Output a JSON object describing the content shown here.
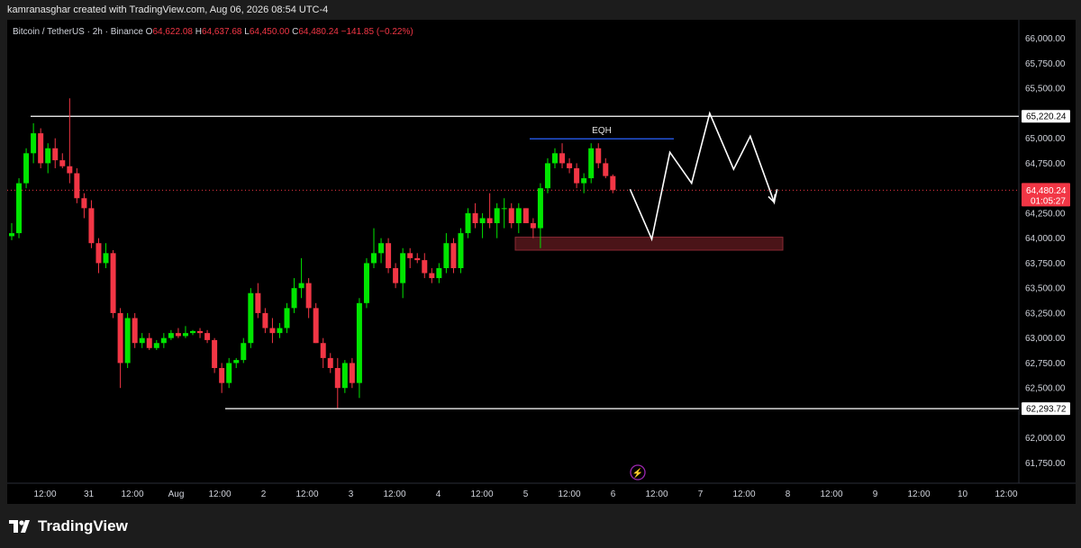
{
  "header": {
    "credit": "kamranasghar created with TradingView.com, Aug 06, 2026 08:54 UTC-4"
  },
  "legend": {
    "symbol": "Bitcoin / TetherUS · 2h · Binance",
    "o_label": "O",
    "o_value": "64,622.08",
    "h_label": "H",
    "h_value": "64,637.68",
    "l_label": "L",
    "l_value": "64,450.00",
    "c_label": "C",
    "c_value": "64,480.24",
    "change": "−141.85 (−0.22%)"
  },
  "brand": {
    "name": "TradingView"
  },
  "colors": {
    "up": "#00e600",
    "down": "#f23645",
    "level_line": "#ffffff",
    "eqh_line": "#2962ff",
    "zone": "#4a1418"
  },
  "chart_data": {
    "type": "candlestick",
    "symbol": "Bitcoin / TetherUS",
    "interval": "2h",
    "exchange": "Binance",
    "ylim": [
      61600,
      66150
    ],
    "y_ticks": [
      {
        "value": 66000,
        "label": "66,000.00"
      },
      {
        "value": 65750,
        "label": "65,750.00"
      },
      {
        "value": 65500,
        "label": "65,500.00"
      },
      {
        "value": 65000,
        "label": "65,000.00"
      },
      {
        "value": 64750,
        "label": "64,750.00"
      },
      {
        "value": 64250,
        "label": "64,250.00"
      },
      {
        "value": 64000,
        "label": "64,000.00"
      },
      {
        "value": 63750,
        "label": "63,750.00"
      },
      {
        "value": 63500,
        "label": "63,500.00"
      },
      {
        "value": 63250,
        "label": "63,250.00"
      },
      {
        "value": 63000,
        "label": "63,000.00"
      },
      {
        "value": 62750,
        "label": "62,750.00"
      },
      {
        "value": 62500,
        "label": "62,500.00"
      },
      {
        "value": 62000,
        "label": "62,000.00"
      },
      {
        "value": 61750,
        "label": "61,750.00"
      }
    ],
    "x_ticks": [
      "12:00",
      "31",
      "12:00",
      "Aug",
      "12:00",
      "2",
      "12:00",
      "3",
      "12:00",
      "4",
      "12:00",
      "5",
      "12:00",
      "6",
      "12:00",
      "7",
      "12:00",
      "8",
      "12:00",
      "9",
      "12:00",
      "10",
      "12:00"
    ],
    "candles": [
      {
        "o": 64020,
        "h": 64150,
        "l": 63980,
        "c": 64050
      },
      {
        "o": 64050,
        "h": 64600,
        "l": 64000,
        "c": 64550
      },
      {
        "o": 64550,
        "h": 64900,
        "l": 64500,
        "c": 64850
      },
      {
        "o": 64850,
        "h": 65150,
        "l": 64750,
        "c": 65050
      },
      {
        "o": 65050,
        "h": 65100,
        "l": 64700,
        "c": 64750
      },
      {
        "o": 64750,
        "h": 64950,
        "l": 64650,
        "c": 64900
      },
      {
        "o": 64900,
        "h": 65000,
        "l": 64700,
        "c": 64780
      },
      {
        "o": 64780,
        "h": 64850,
        "l": 64700,
        "c": 64720
      },
      {
        "o": 64720,
        "h": 65400,
        "l": 64550,
        "c": 64650
      },
      {
        "o": 64650,
        "h": 64700,
        "l": 64350,
        "c": 64400
      },
      {
        "o": 64400,
        "h": 64450,
        "l": 64200,
        "c": 64300
      },
      {
        "o": 64300,
        "h": 64380,
        "l": 63900,
        "c": 63950
      },
      {
        "o": 63950,
        "h": 64000,
        "l": 63650,
        "c": 63750
      },
      {
        "o": 63750,
        "h": 63950,
        "l": 63700,
        "c": 63850
      },
      {
        "o": 63850,
        "h": 63880,
        "l": 63200,
        "c": 63250
      },
      {
        "o": 63250,
        "h": 63300,
        "l": 62500,
        "c": 62750
      },
      {
        "o": 62750,
        "h": 63250,
        "l": 62700,
        "c": 63200
      },
      {
        "o": 63200,
        "h": 63250,
        "l": 62900,
        "c": 62950
      },
      {
        "o": 62950,
        "h": 63050,
        "l": 62900,
        "c": 63000
      },
      {
        "o": 63000,
        "h": 63050,
        "l": 62880,
        "c": 62900
      },
      {
        "o": 62900,
        "h": 62980,
        "l": 62880,
        "c": 62950
      },
      {
        "o": 62950,
        "h": 63050,
        "l": 62900,
        "c": 63000
      },
      {
        "o": 63000,
        "h": 63080,
        "l": 62980,
        "c": 63050
      },
      {
        "o": 63050,
        "h": 63100,
        "l": 63000,
        "c": 63020
      },
      {
        "o": 63020,
        "h": 63120,
        "l": 63000,
        "c": 63050
      },
      {
        "o": 63050,
        "h": 63080,
        "l": 63030,
        "c": 63070
      },
      {
        "o": 63070,
        "h": 63100,
        "l": 63000,
        "c": 63050
      },
      {
        "o": 63050,
        "h": 63080,
        "l": 62950,
        "c": 62980
      },
      {
        "o": 62980,
        "h": 63000,
        "l": 62650,
        "c": 62700
      },
      {
        "o": 62700,
        "h": 62750,
        "l": 62450,
        "c": 62550
      },
      {
        "o": 62550,
        "h": 62800,
        "l": 62500,
        "c": 62750
      },
      {
        "o": 62750,
        "h": 62800,
        "l": 62700,
        "c": 62780
      },
      {
        "o": 62780,
        "h": 63000,
        "l": 62750,
        "c": 62950
      },
      {
        "o": 62950,
        "h": 63500,
        "l": 62900,
        "c": 63450
      },
      {
        "o": 63450,
        "h": 63550,
        "l": 63200,
        "c": 63250
      },
      {
        "o": 63250,
        "h": 63300,
        "l": 63050,
        "c": 63100
      },
      {
        "o": 63100,
        "h": 63200,
        "l": 62950,
        "c": 63050
      },
      {
        "o": 63050,
        "h": 63150,
        "l": 63000,
        "c": 63100
      },
      {
        "o": 63100,
        "h": 63350,
        "l": 63050,
        "c": 63300
      },
      {
        "o": 63300,
        "h": 63600,
        "l": 63250,
        "c": 63500
      },
      {
        "o": 63500,
        "h": 63800,
        "l": 63400,
        "c": 63550
      },
      {
        "o": 63550,
        "h": 63600,
        "l": 63200,
        "c": 63300
      },
      {
        "o": 63300,
        "h": 63350,
        "l": 62950,
        "c": 62950
      },
      {
        "o": 62950,
        "h": 63000,
        "l": 62700,
        "c": 62800
      },
      {
        "o": 62800,
        "h": 62850,
        "l": 62650,
        "c": 62700
      },
      {
        "o": 62700,
        "h": 62800,
        "l": 62300,
        "c": 62500
      },
      {
        "o": 62500,
        "h": 62780,
        "l": 62450,
        "c": 62750
      },
      {
        "o": 62750,
        "h": 62800,
        "l": 62500,
        "c": 62550
      },
      {
        "o": 62550,
        "h": 63400,
        "l": 62400,
        "c": 63350
      },
      {
        "o": 63350,
        "h": 63800,
        "l": 63300,
        "c": 63750
      },
      {
        "o": 63750,
        "h": 64100,
        "l": 63700,
        "c": 63850
      },
      {
        "o": 63850,
        "h": 64000,
        "l": 63750,
        "c": 63950
      },
      {
        "o": 63950,
        "h": 64000,
        "l": 63650,
        "c": 63700
      },
      {
        "o": 63700,
        "h": 63750,
        "l": 63500,
        "c": 63550
      },
      {
        "o": 63550,
        "h": 63900,
        "l": 63400,
        "c": 63850
      },
      {
        "o": 63850,
        "h": 63900,
        "l": 63700,
        "c": 63800
      },
      {
        "o": 63800,
        "h": 63850,
        "l": 63750,
        "c": 63780
      },
      {
        "o": 63780,
        "h": 63850,
        "l": 63600,
        "c": 63650
      },
      {
        "o": 63650,
        "h": 63700,
        "l": 63550,
        "c": 63600
      },
      {
        "o": 63600,
        "h": 63750,
        "l": 63550,
        "c": 63700
      },
      {
        "o": 63700,
        "h": 64050,
        "l": 63650,
        "c": 63950
      },
      {
        "o": 63950,
        "h": 64000,
        "l": 63650,
        "c": 63700
      },
      {
        "o": 63700,
        "h": 64100,
        "l": 63650,
        "c": 64050
      },
      {
        "o": 64050,
        "h": 64300,
        "l": 64000,
        "c": 64250
      },
      {
        "o": 64250,
        "h": 64350,
        "l": 64100,
        "c": 64150
      },
      {
        "o": 64150,
        "h": 64250,
        "l": 64000,
        "c": 64200
      },
      {
        "o": 64200,
        "h": 64450,
        "l": 64100,
        "c": 64150
      },
      {
        "o": 64150,
        "h": 64350,
        "l": 64000,
        "c": 64300
      },
      {
        "o": 64300,
        "h": 64400,
        "l": 64100,
        "c": 64300
      },
      {
        "o": 64300,
        "h": 64350,
        "l": 64100,
        "c": 64150
      },
      {
        "o": 64150,
        "h": 64350,
        "l": 64050,
        "c": 64300
      },
      {
        "o": 64300,
        "h": 64300,
        "l": 64150,
        "c": 64150
      },
      {
        "o": 64150,
        "h": 64200,
        "l": 64000,
        "c": 64100
      },
      {
        "o": 64100,
        "h": 64550,
        "l": 63900,
        "c": 64500
      },
      {
        "o": 64500,
        "h": 64800,
        "l": 64450,
        "c": 64750
      },
      {
        "o": 64750,
        "h": 64900,
        "l": 64700,
        "c": 64850
      },
      {
        "o": 64850,
        "h": 64950,
        "l": 64700,
        "c": 64750
      },
      {
        "o": 64750,
        "h": 64800,
        "l": 64650,
        "c": 64700
      },
      {
        "o": 64700,
        "h": 64750,
        "l": 64500,
        "c": 64550
      },
      {
        "o": 64550,
        "h": 64650,
        "l": 64450,
        "c": 64600
      },
      {
        "o": 64600,
        "h": 64950,
        "l": 64550,
        "c": 64900
      },
      {
        "o": 64900,
        "h": 64950,
        "l": 64700,
        "c": 64750
      },
      {
        "o": 64750,
        "h": 64800,
        "l": 64600,
        "c": 64622
      },
      {
        "o": 64622,
        "h": 64638,
        "l": 64450,
        "c": 64480
      }
    ],
    "horizontal_levels": [
      {
        "value": 65220.24,
        "label": "65,220.24"
      },
      {
        "value": 62293.72,
        "label": "62,293.72"
      }
    ],
    "annotations": [
      {
        "type": "line",
        "label": "EQH",
        "value": 64995
      },
      {
        "type": "zone",
        "from": 63880,
        "to": 64010
      },
      {
        "type": "projection_path",
        "from_candle": 84,
        "path": [
          {
            "bar": 85.0,
            "value": 64490
          },
          {
            "bar": 88.0,
            "value": 63990
          },
          {
            "bar": 90.5,
            "value": 64860
          },
          {
            "bar": 93.5,
            "value": 64550
          },
          {
            "bar": 96.0,
            "value": 65250
          },
          {
            "bar": 99.3,
            "value": 64690
          },
          {
            "bar": 101.6,
            "value": 65020
          },
          {
            "bar": 104.9,
            "value": 64360
          },
          {
            "bar": 105.3,
            "value": 64490
          }
        ]
      }
    ],
    "last_price": {
      "value": 64480.24,
      "label": "64,480.24",
      "countdown": "01:05:27"
    }
  }
}
